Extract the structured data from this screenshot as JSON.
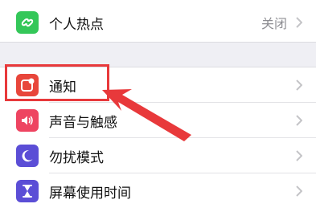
{
  "rows": {
    "hotspot": {
      "label": "个人热点",
      "value": "关闭",
      "icon": "link-icon",
      "color": "#34c759"
    },
    "notifications": {
      "label": "通知",
      "icon": "notification-icon",
      "color": "#e8463b"
    },
    "sounds": {
      "label": "声音与触感",
      "icon": "speaker-icon",
      "color": "#ee4461"
    },
    "dnd": {
      "label": "勿扰模式",
      "icon": "moon-icon",
      "color": "#5b4ed6"
    },
    "screen_time": {
      "label": "屏幕使用时间",
      "icon": "hourglass-icon",
      "color": "#5b4ed6"
    }
  },
  "annotation": {
    "color": "#e8393b"
  }
}
